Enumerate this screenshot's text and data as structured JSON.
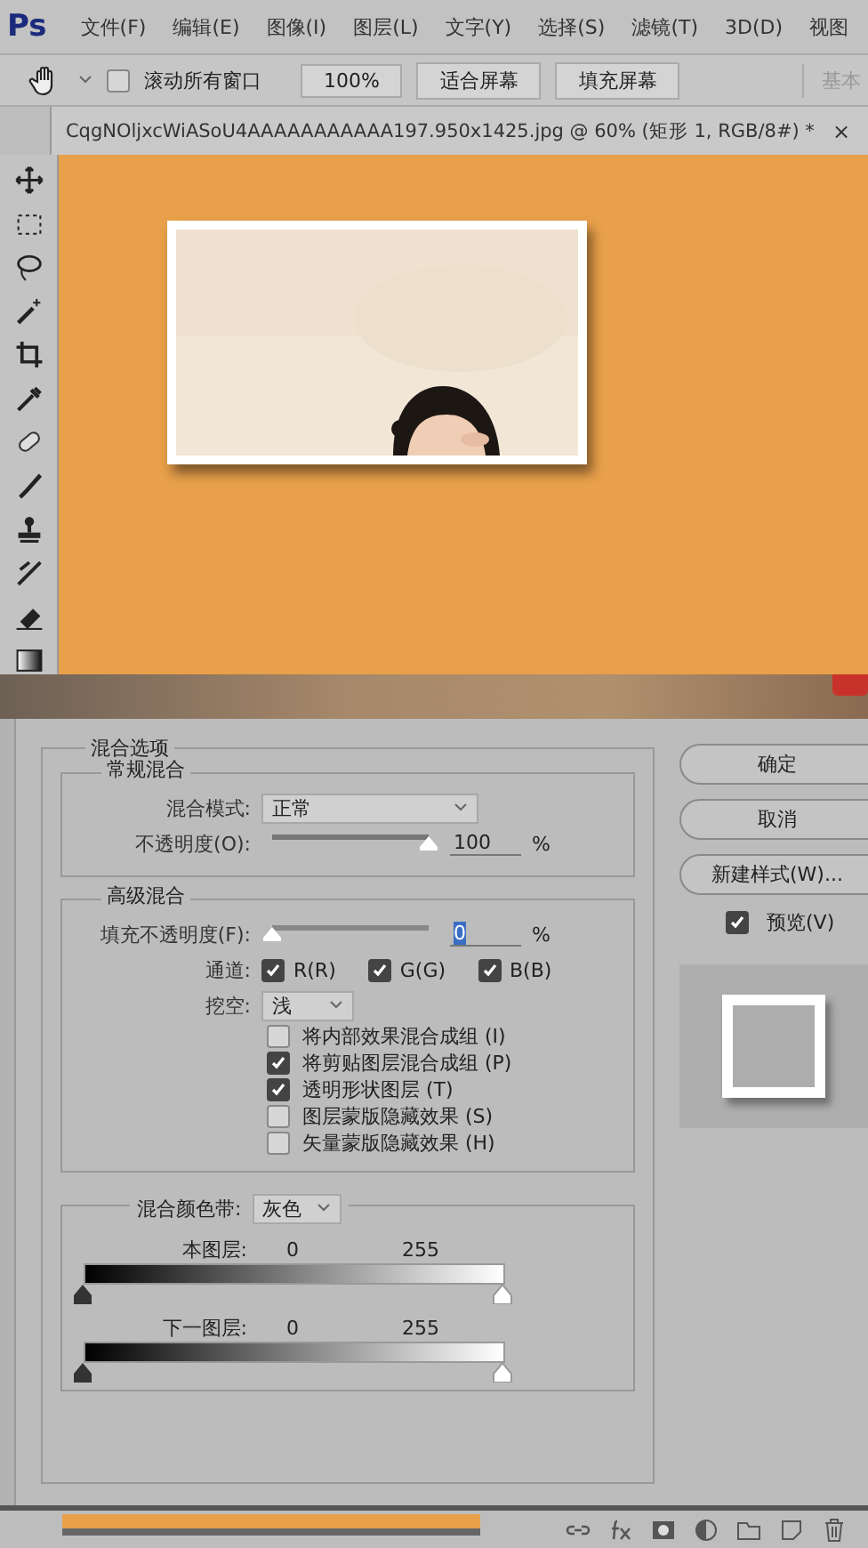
{
  "menu_bar": {
    "logo": "Ps",
    "items": [
      "文件(F)",
      "编辑(E)",
      "图像(I)",
      "图层(L)",
      "文字(Y)",
      "选择(S)",
      "滤镜(T)",
      "3D(D)",
      "视图"
    ]
  },
  "options_bar": {
    "scroll_all": {
      "label": "滚动所有窗口",
      "checked": false
    },
    "buttons": [
      "100%",
      "适合屏幕",
      "填充屏幕"
    ],
    "workspace": "基本"
  },
  "document_tab": {
    "title": "CqgNOljxcWiASoU4AAAAAAAAAAA197.950x1425.jpg @ 60% (矩形 1, RGB/8#) *",
    "close": "×"
  },
  "dialog": {
    "group_title": "混合选项",
    "general": {
      "title": "常规混合",
      "blend_mode_label": "混合模式:",
      "blend_mode": "正常",
      "opacity_label": "不透明度(O):",
      "opacity": {
        "level": 1,
        "value": "100",
        "unit": "%"
      }
    },
    "advanced": {
      "title": "高级混合",
      "fill_label": "填充不透明度(F):",
      "fill": {
        "level": 0,
        "value": "0",
        "unit": "%"
      },
      "channels_label": "通道:",
      "channels": [
        {
          "label": "R(R)",
          "checked": true
        },
        {
          "label": "G(G)",
          "checked": true
        },
        {
          "label": "B(B)",
          "checked": true
        }
      ],
      "knockout_label": "挖空:",
      "knockout": "浅",
      "options": [
        {
          "label": "将内部效果混合成组 (I)",
          "checked": false
        },
        {
          "label": "将剪贴图层混合成组 (P)",
          "checked": true
        },
        {
          "label": "透明形状图层 (T)",
          "checked": true
        },
        {
          "label": "图层蒙版隐藏效果 (S)",
          "checked": false
        },
        {
          "label": "矢量蒙版隐藏效果 (H)",
          "checked": false
        }
      ]
    },
    "blend_if": {
      "label": "混合颜色带:",
      "value": "灰色",
      "layers": [
        {
          "label": "本图层:",
          "min": "0",
          "max": "255"
        },
        {
          "label": "下一图层:",
          "min": "0",
          "max": "255"
        }
      ]
    },
    "buttons": [
      "确定",
      "取消",
      "新建样式(W)..."
    ],
    "preview": {
      "label": "预览(V)",
      "checked": true
    }
  }
}
